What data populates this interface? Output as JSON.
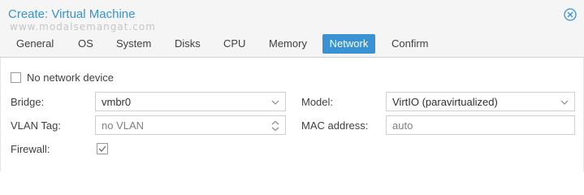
{
  "window": {
    "title": "Create: Virtual Machine",
    "watermark": "www.modalsemangat.com",
    "accent_color": "#3892d4"
  },
  "tabs": [
    {
      "label": "General",
      "active": false
    },
    {
      "label": "OS",
      "active": false
    },
    {
      "label": "System",
      "active": false
    },
    {
      "label": "Disks",
      "active": false
    },
    {
      "label": "CPU",
      "active": false
    },
    {
      "label": "Memory",
      "active": false
    },
    {
      "label": "Network",
      "active": true
    },
    {
      "label": "Confirm",
      "active": false
    }
  ],
  "form": {
    "no_network_device": {
      "label": "No network device",
      "checked": false
    },
    "bridge": {
      "label": "Bridge:",
      "value": "vmbr0",
      "icon": "chevron-down-icon"
    },
    "vlan_tag": {
      "label": "VLAN Tag:",
      "placeholder": "no VLAN",
      "icon": "spinner-arrows-icon"
    },
    "firewall": {
      "label": "Firewall:",
      "checked": true
    },
    "model": {
      "label": "Model:",
      "value": "VirtIO (paravirtualized)",
      "icon": "chevron-down-icon"
    },
    "mac_address": {
      "label": "MAC address:",
      "placeholder": "auto"
    }
  }
}
